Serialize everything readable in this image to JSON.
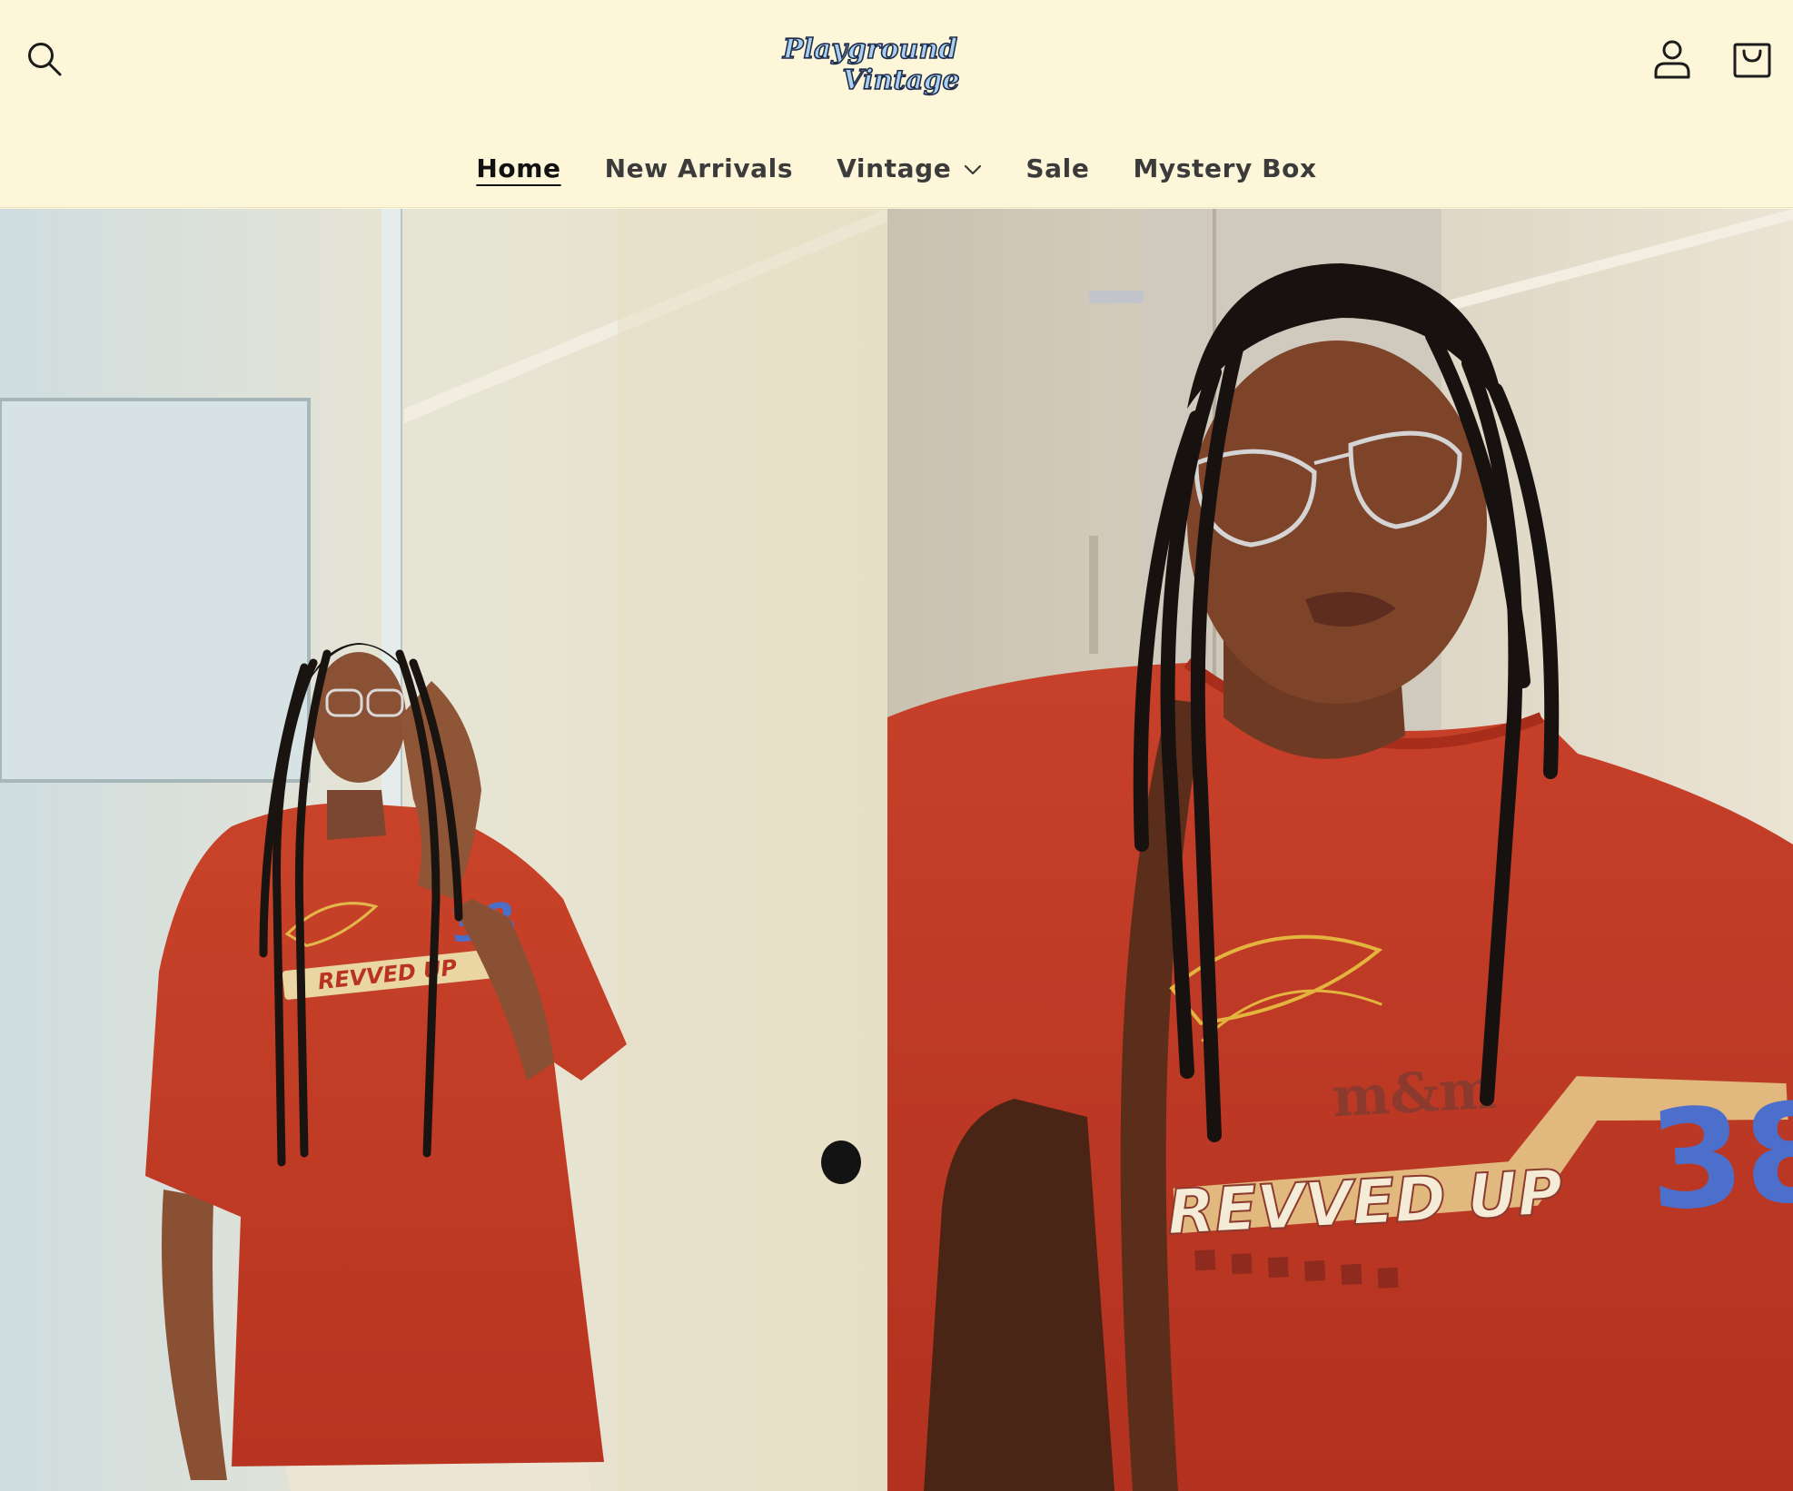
{
  "header": {
    "logo": {
      "line1": "Playground",
      "line2": "Vintage"
    },
    "icons": {
      "search": "search-icon",
      "account": "account-icon",
      "cart": "cart-icon"
    }
  },
  "nav": {
    "items": [
      {
        "label": "Home",
        "active": true
      },
      {
        "label": "New Arrivals"
      },
      {
        "label": "Vintage",
        "has_dropdown": true
      },
      {
        "label": "Sale"
      },
      {
        "label": "Mystery Box"
      }
    ]
  },
  "hero": {
    "left_image": "model-full-length-photo",
    "right_image": "model-closeup-photo",
    "shirt_print": {
      "text": "REVVED UP",
      "number": "38"
    }
  },
  "colors": {
    "header_bg": "#fdf6d8",
    "nav_text": "#3b3b3b",
    "shirt_red": "#c23a22",
    "logo_blue": "#a9d0f0"
  }
}
